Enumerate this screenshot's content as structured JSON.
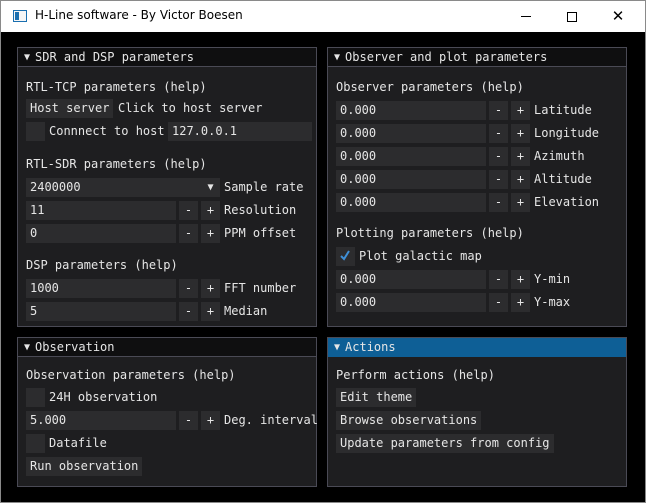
{
  "window": {
    "title": "H-Line software - By Victor Boesen",
    "minimize": "minimize",
    "maximize": "maximize",
    "close": "✕"
  },
  "sdr": {
    "header": "SDR and DSP parameters",
    "rtltcp_heading": "RTL-TCP parameters (help)",
    "host_server_btn": "Host server",
    "host_server_hint": "Click to host server",
    "connect_label": "Connnect to host",
    "host_value": "127.0.0.1",
    "rtlsdr_heading": "RTL-SDR parameters (help)",
    "sample_rate_value": "2400000",
    "sample_rate_label": "Sample rate",
    "resolution_value": "11",
    "resolution_label": "Resolution",
    "ppm_value": "0",
    "ppm_label": "PPM offset",
    "dsp_heading": "DSP parameters (help)",
    "fft_value": "1000",
    "fft_label": "FFT number",
    "median_value": "5",
    "median_label": "Median"
  },
  "observer": {
    "header": "Observer and plot parameters",
    "params_heading": "Observer parameters (help)",
    "latitude_value": "0.000",
    "latitude_label": "Latitude",
    "longitude_value": "0.000",
    "longitude_label": "Longitude",
    "azimuth_value": "0.000",
    "azimuth_label": "Azimuth",
    "altitude_value": "0.000",
    "altitude_label": "Altitude",
    "elevation_value": "0.000",
    "elevation_label": "Elevation",
    "plotting_heading": "Plotting parameters (help)",
    "plot_galactic_label": "Plot galactic map",
    "plot_galactic_checked": true,
    "ymin_value": "0.000",
    "ymin_label": "Y-min",
    "ymax_value": "0.000",
    "ymax_label": "Y-max"
  },
  "observation": {
    "header": "Observation",
    "params_heading": "Observation parameters (help)",
    "h24_label": "24H observation",
    "deg_value": "5.000",
    "deg_label": "Deg. interval",
    "datafile_label": "Datafile",
    "run_btn": "Run observation"
  },
  "actions": {
    "header": "Actions",
    "heading": "Perform actions (help)",
    "edit_theme": "Edit theme",
    "browse": "Browse observations",
    "update": "Update parameters from config"
  },
  "stepper": {
    "minus": "-",
    "plus": "+"
  },
  "colors": {
    "accent": "#0e5f96",
    "check": "#3f8fd6",
    "panel_bg": "#1e1e20",
    "widget_bg": "#2c2c2e"
  }
}
